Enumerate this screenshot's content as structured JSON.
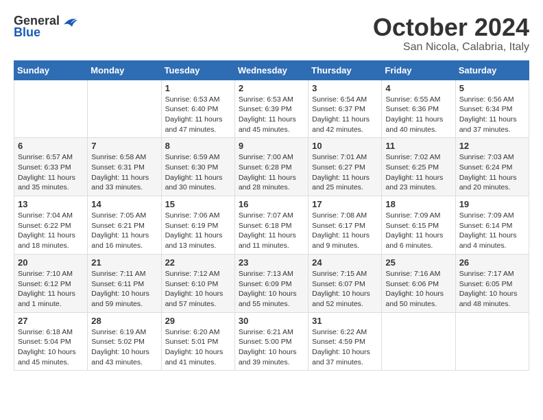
{
  "logo": {
    "general": "General",
    "blue": "Blue"
  },
  "header": {
    "title": "October 2024",
    "subtitle": "San Nicola, Calabria, Italy"
  },
  "columns": [
    "Sunday",
    "Monday",
    "Tuesday",
    "Wednesday",
    "Thursday",
    "Friday",
    "Saturday"
  ],
  "weeks": [
    [
      {
        "day": "",
        "detail": ""
      },
      {
        "day": "",
        "detail": ""
      },
      {
        "day": "1",
        "detail": "Sunrise: 6:53 AM\nSunset: 6:40 PM\nDaylight: 11 hours and 47 minutes."
      },
      {
        "day": "2",
        "detail": "Sunrise: 6:53 AM\nSunset: 6:39 PM\nDaylight: 11 hours and 45 minutes."
      },
      {
        "day": "3",
        "detail": "Sunrise: 6:54 AM\nSunset: 6:37 PM\nDaylight: 11 hours and 42 minutes."
      },
      {
        "day": "4",
        "detail": "Sunrise: 6:55 AM\nSunset: 6:36 PM\nDaylight: 11 hours and 40 minutes."
      },
      {
        "day": "5",
        "detail": "Sunrise: 6:56 AM\nSunset: 6:34 PM\nDaylight: 11 hours and 37 minutes."
      }
    ],
    [
      {
        "day": "6",
        "detail": "Sunrise: 6:57 AM\nSunset: 6:33 PM\nDaylight: 11 hours and 35 minutes."
      },
      {
        "day": "7",
        "detail": "Sunrise: 6:58 AM\nSunset: 6:31 PM\nDaylight: 11 hours and 33 minutes."
      },
      {
        "day": "8",
        "detail": "Sunrise: 6:59 AM\nSunset: 6:30 PM\nDaylight: 11 hours and 30 minutes."
      },
      {
        "day": "9",
        "detail": "Sunrise: 7:00 AM\nSunset: 6:28 PM\nDaylight: 11 hours and 28 minutes."
      },
      {
        "day": "10",
        "detail": "Sunrise: 7:01 AM\nSunset: 6:27 PM\nDaylight: 11 hours and 25 minutes."
      },
      {
        "day": "11",
        "detail": "Sunrise: 7:02 AM\nSunset: 6:25 PM\nDaylight: 11 hours and 23 minutes."
      },
      {
        "day": "12",
        "detail": "Sunrise: 7:03 AM\nSunset: 6:24 PM\nDaylight: 11 hours and 20 minutes."
      }
    ],
    [
      {
        "day": "13",
        "detail": "Sunrise: 7:04 AM\nSunset: 6:22 PM\nDaylight: 11 hours and 18 minutes."
      },
      {
        "day": "14",
        "detail": "Sunrise: 7:05 AM\nSunset: 6:21 PM\nDaylight: 11 hours and 16 minutes."
      },
      {
        "day": "15",
        "detail": "Sunrise: 7:06 AM\nSunset: 6:19 PM\nDaylight: 11 hours and 13 minutes."
      },
      {
        "day": "16",
        "detail": "Sunrise: 7:07 AM\nSunset: 6:18 PM\nDaylight: 11 hours and 11 minutes."
      },
      {
        "day": "17",
        "detail": "Sunrise: 7:08 AM\nSunset: 6:17 PM\nDaylight: 11 hours and 9 minutes."
      },
      {
        "day": "18",
        "detail": "Sunrise: 7:09 AM\nSunset: 6:15 PM\nDaylight: 11 hours and 6 minutes."
      },
      {
        "day": "19",
        "detail": "Sunrise: 7:09 AM\nSunset: 6:14 PM\nDaylight: 11 hours and 4 minutes."
      }
    ],
    [
      {
        "day": "20",
        "detail": "Sunrise: 7:10 AM\nSunset: 6:12 PM\nDaylight: 11 hours and 1 minute."
      },
      {
        "day": "21",
        "detail": "Sunrise: 7:11 AM\nSunset: 6:11 PM\nDaylight: 10 hours and 59 minutes."
      },
      {
        "day": "22",
        "detail": "Sunrise: 7:12 AM\nSunset: 6:10 PM\nDaylight: 10 hours and 57 minutes."
      },
      {
        "day": "23",
        "detail": "Sunrise: 7:13 AM\nSunset: 6:09 PM\nDaylight: 10 hours and 55 minutes."
      },
      {
        "day": "24",
        "detail": "Sunrise: 7:15 AM\nSunset: 6:07 PM\nDaylight: 10 hours and 52 minutes."
      },
      {
        "day": "25",
        "detail": "Sunrise: 7:16 AM\nSunset: 6:06 PM\nDaylight: 10 hours and 50 minutes."
      },
      {
        "day": "26",
        "detail": "Sunrise: 7:17 AM\nSunset: 6:05 PM\nDaylight: 10 hours and 48 minutes."
      }
    ],
    [
      {
        "day": "27",
        "detail": "Sunrise: 6:18 AM\nSunset: 5:04 PM\nDaylight: 10 hours and 45 minutes."
      },
      {
        "day": "28",
        "detail": "Sunrise: 6:19 AM\nSunset: 5:02 PM\nDaylight: 10 hours and 43 minutes."
      },
      {
        "day": "29",
        "detail": "Sunrise: 6:20 AM\nSunset: 5:01 PM\nDaylight: 10 hours and 41 minutes."
      },
      {
        "day": "30",
        "detail": "Sunrise: 6:21 AM\nSunset: 5:00 PM\nDaylight: 10 hours and 39 minutes."
      },
      {
        "day": "31",
        "detail": "Sunrise: 6:22 AM\nSunset: 4:59 PM\nDaylight: 10 hours and 37 minutes."
      },
      {
        "day": "",
        "detail": ""
      },
      {
        "day": "",
        "detail": ""
      }
    ]
  ]
}
